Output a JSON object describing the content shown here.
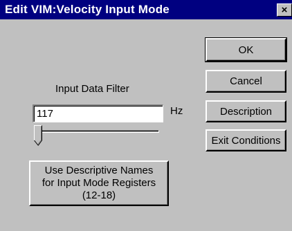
{
  "window": {
    "title": "Edit VIM:Velocity Input Mode",
    "close_glyph": "×"
  },
  "buttons": {
    "ok": "OK",
    "cancel": "Cancel",
    "description": "Description",
    "exit_conditions": "Exit Conditions"
  },
  "filter": {
    "label": "Input Data Filter",
    "value": "117",
    "unit": "Hz",
    "slider_level": 0.0
  },
  "names_button": {
    "line1": "Use Descriptive Names",
    "line2": "for Input Mode Registers",
    "line3": "(12-18)"
  }
}
